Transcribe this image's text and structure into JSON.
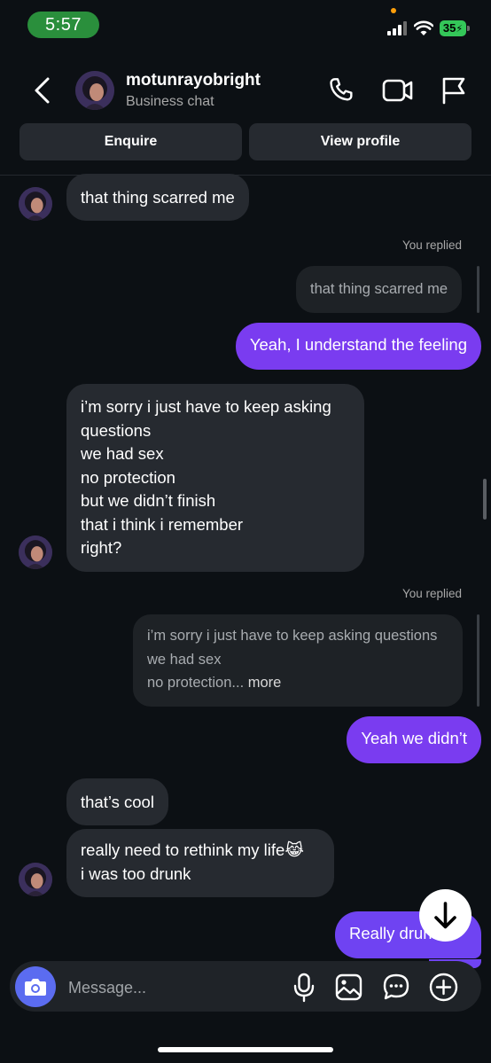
{
  "status_bar": {
    "time": "5:57",
    "battery": "35"
  },
  "header": {
    "username": "motunrayobright",
    "subtitle": "Business chat",
    "buttons": {
      "enquire": "Enquire",
      "view_profile": "View profile"
    },
    "icons": [
      "back-chevron-icon",
      "phone-icon",
      "video-camera-icon",
      "flag-icon"
    ]
  },
  "messages": {
    "m1": "that thing scarred me",
    "reply1": {
      "label": "You replied",
      "quote": "that thing scarred me",
      "text": "Yeah, I understand the feeling"
    },
    "m2": "i’m sorry i just have to keep asking\nquestions\nwe had sex\nno protection\nbut we didn’t finish\nthat i think i remember\nright?",
    "reply2": {
      "label": "You replied",
      "quote": "i’m sorry i just have to keep asking questions\nwe had sex\nno protection...",
      "more": " more",
      "text": "Yeah we didn’t"
    },
    "m3": "that’s cool",
    "m4": "really need to rethink my life😹\ni was too drunk",
    "m5": "Really drunk"
  },
  "composer": {
    "placeholder": "Message...",
    "icons": [
      "camera-icon",
      "microphone-icon",
      "gallery-icon",
      "sticker-chat-icon",
      "add-icon"
    ]
  },
  "colors": {
    "background": "#0c1014",
    "incoming_bubble": "#262a30",
    "outgoing_bubble": "#7a3cf0",
    "camera_button": "#5b6cf0",
    "time_pill": "#2a8f3c"
  }
}
